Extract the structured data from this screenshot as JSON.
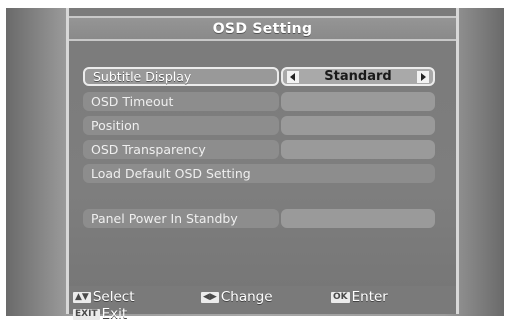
{
  "window": {
    "title": "OSD Setting"
  },
  "menu": {
    "items": [
      {
        "label": "Subtitle Display",
        "value": "Standard"
      },
      {
        "label": "OSD Timeout",
        "value": ""
      },
      {
        "label": "Position",
        "value": ""
      },
      {
        "label": "OSD Transparency",
        "value": ""
      },
      {
        "label": "Load Default OSD Setting"
      },
      {
        "label": "Panel Power In Standby",
        "value": ""
      }
    ]
  },
  "hints": {
    "select_key": "▲▼",
    "select_label": "Select",
    "change_key": "◀▶",
    "change_label": "Change",
    "ok_key": "OK",
    "ok_label": "Enter",
    "exit_key": "EXIT",
    "exit_label": "Exit"
  },
  "icons": {
    "left": "arrow-left-icon",
    "right": "arrow-right-icon"
  }
}
